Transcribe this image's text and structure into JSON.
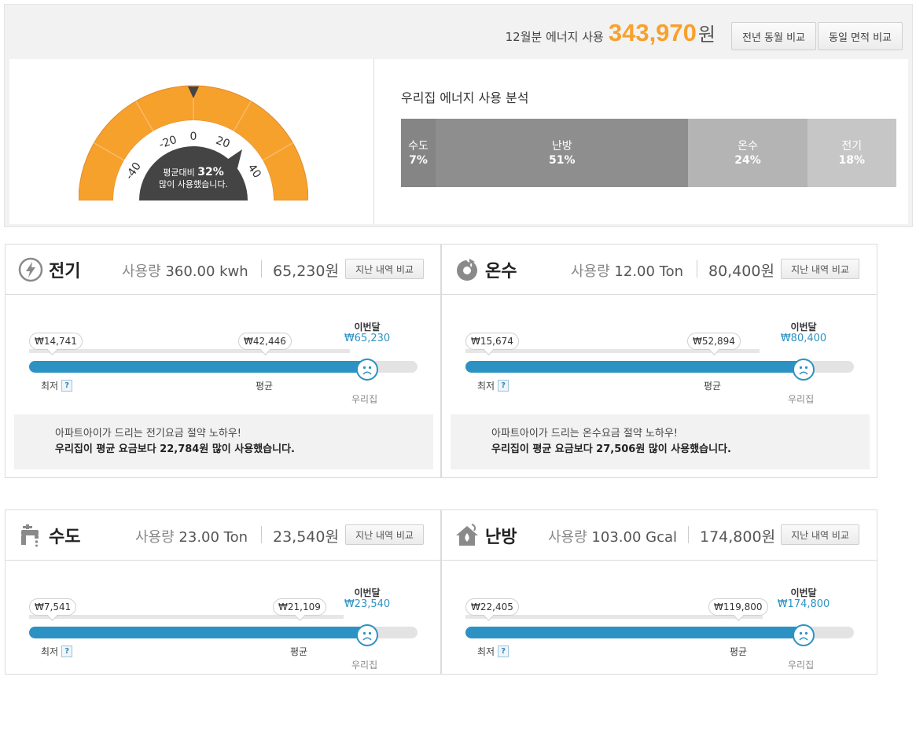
{
  "summary": {
    "total_label": "12월분 에너지 사용",
    "total_amount": "343,970",
    "total_unit": "원",
    "compare_yoy_label": "전년 동월 비교",
    "compare_area_label": "동일 면적 비교",
    "gauge": {
      "tick_labels": [
        "-40",
        "-20",
        "0",
        "20",
        "40"
      ],
      "line1_prefix": "평균대비",
      "percent": "32%",
      "line2": "많이 사용했습니다.",
      "colors": {
        "arc": "#f7a12d",
        "center": "#444444",
        "needle": "#444444"
      }
    },
    "analysis": {
      "title": "우리집 에너지 사용 분석",
      "segments": [
        {
          "name": "수도",
          "percent": "7%",
          "share": 0.07,
          "color": "#858585"
        },
        {
          "name": "난방",
          "percent": "51%",
          "share": 0.51,
          "color": "#8e8e8e"
        },
        {
          "name": "온수",
          "percent": "24%",
          "share": 0.24,
          "color": "#b4b4b4"
        },
        {
          "name": "전기",
          "percent": "18%",
          "share": 0.18,
          "color": "#c6c6c6"
        }
      ]
    }
  },
  "cards": {
    "elec": {
      "icon": "lightning-icon",
      "title": "전기",
      "usage_prefix": "사용량",
      "usage_value": "360.00 kwh",
      "cost": "65,230원",
      "history_btn": "지난 내역 비교",
      "min_value": "₩14,741",
      "avg_value": "₩42,446",
      "this_label": "이번달",
      "this_value": "₩65,230",
      "min_label": "최저",
      "help": "?",
      "avg_label": "평균",
      "ours_label": "우리집",
      "fill_fraction": 0.87,
      "tip_line1": "아파트아이가 드리는 전기요금 절약 노하우!",
      "tip_line2": "우리집이 평균 요금보다 22,784원 많이 사용했습니다."
    },
    "hot": {
      "icon": "hot-water-icon",
      "title": "온수",
      "usage_prefix": "사용량",
      "usage_value": "12.00 Ton",
      "cost": "80,400원",
      "history_btn": "지난 내역 비교",
      "min_value": "₩15,674",
      "avg_value": "₩52,894",
      "this_label": "이번달",
      "this_value": "₩80,400",
      "min_label": "최저",
      "help": "?",
      "avg_label": "평균",
      "ours_label": "우리집",
      "fill_fraction": 0.87,
      "tip_line1": "아파트아이가 드리는 온수요금 절약 노하우!",
      "tip_line2": "우리집이 평균 요금보다 27,506원 많이 사용했습니다."
    },
    "water": {
      "icon": "faucet-icon",
      "title": "수도",
      "usage_prefix": "사용량",
      "usage_value": "23.00 Ton",
      "cost": "23,540원",
      "history_btn": "지난 내역 비교",
      "min_value": "₩7,541",
      "avg_value": "₩21,109",
      "this_label": "이번달",
      "this_value": "₩23,540",
      "min_label": "최저",
      "help": "?",
      "avg_label": "평균",
      "ours_label": "우리집",
      "fill_fraction": 0.87
    },
    "heat": {
      "icon": "house-heating-icon",
      "title": "난방",
      "usage_prefix": "사용량",
      "usage_value": "103.00 Gcal",
      "cost": "174,800원",
      "history_btn": "지난 내역 비교",
      "min_value": "₩22,405",
      "avg_value": "₩119,800",
      "this_label": "이번달",
      "this_value": "₩174,800",
      "min_label": "최저",
      "help": "?",
      "avg_label": "평균",
      "ours_label": "우리집",
      "fill_fraction": 0.87
    }
  }
}
